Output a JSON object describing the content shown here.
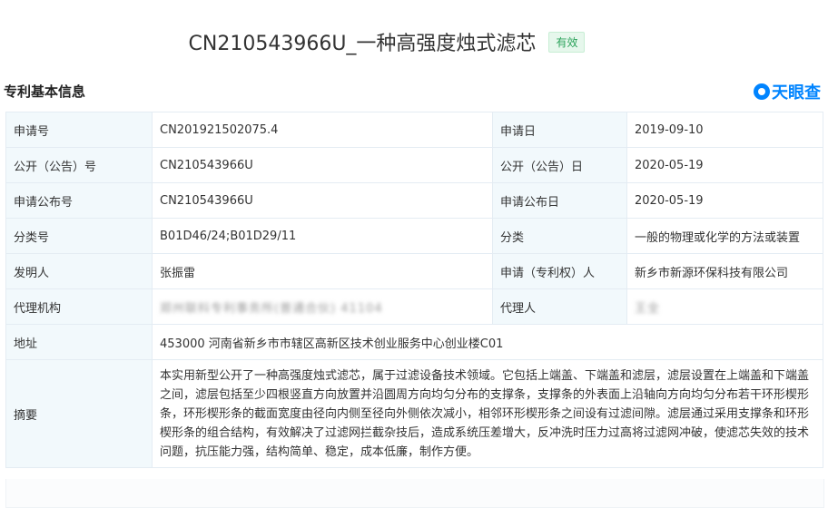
{
  "header": {
    "title": "CN210543966U_一种高强度烛式滤芯",
    "status_badge": "有效"
  },
  "section": {
    "title": "专利基本信息",
    "brand": "天眼查"
  },
  "table": {
    "app_no_label": "申请号",
    "app_no_value": "CN201921502075.4",
    "app_date_label": "申请日",
    "app_date_value": "2019-09-10",
    "pub_no_label": "公开（公告）号",
    "pub_no_value": "CN210543966U",
    "pub_date_label": "公开（公告）日",
    "pub_date_value": "2020-05-19",
    "app_pub_no_label": "申请公布号",
    "app_pub_no_value": "CN210543966U",
    "app_pub_date_label": "申请公布日",
    "app_pub_date_value": "2020-05-19",
    "class_no_label": "分类号",
    "class_no_value": "B01D46/24;B01D29/11",
    "category_label": "分类",
    "category_value": "一般的物理或化学的方法或装置",
    "inventor_label": "发明人",
    "inventor_value": "张振雷",
    "applicant_label": "申请（专利权）人",
    "applicant_value": "新乡市新源环保科技有限公司",
    "agency_label": "代理机构",
    "agency_value": "郑州联科专利事务所(普通合伙) 41104",
    "agent_label": "代理人",
    "agent_value": "王全",
    "address_label": "地址",
    "address_value": "453000 河南省新乡市市辖区高新区技术创业服务中心创业楼C01",
    "abstract_label": "摘要",
    "abstract_value": "本实用新型公开了一种高强度烛式滤芯，属于过滤设备技术领域。它包括上端盖、下端盖和滤层，滤层设置在上端盖和下端盖之间，滤层包括至少四根竖直方向放置并沿圆周方向均匀分布的支撑条，支撑条的外表面上沿轴向方向均匀分布若干环形楔形条，环形楔形条的截面宽度由径向内侧至径向外侧依次减小，相邻环形楔形条之间设有过滤间隙。滤层通过采用支撑条和环形楔形条的组合结构，有效解决了过滤网拦截杂技后，造成系统压差增大，反冲洗时压力过高将过滤网冲破，使滤芯失效的技术问题，抗压能力强，结构简单、稳定，成本低廉，制作方便。"
  },
  "colors": {
    "label_bg": "#f2f9fc",
    "border": "#e4ecf3",
    "badge_green": "#2aa25a",
    "brand_blue": "#0084ff",
    "link_blue": "#1a66c4"
  }
}
